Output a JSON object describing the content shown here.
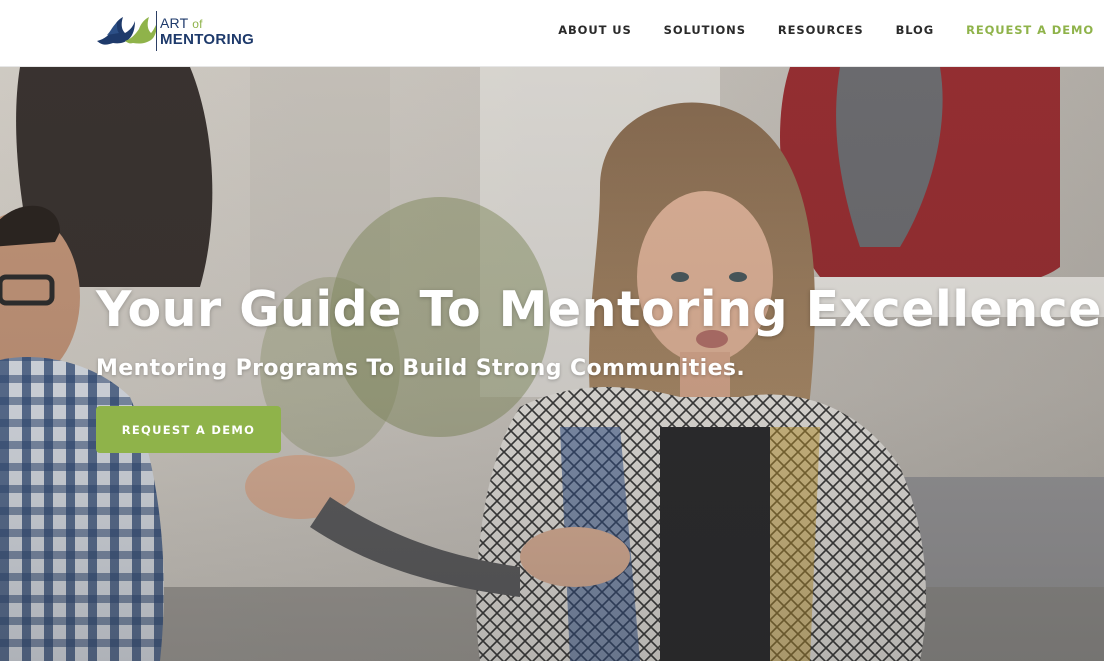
{
  "brand": {
    "logo_line1": "ART",
    "logo_of": "of",
    "logo_line2": "MENTORING",
    "logo_icon": "flying-birds-logo",
    "primary_color": "#1e3a6b",
    "accent_color": "#8fb34a"
  },
  "nav": {
    "items": [
      {
        "label": "ABOUT US"
      },
      {
        "label": "SOLUTIONS"
      },
      {
        "label": "RESOURCES"
      },
      {
        "label": "BLOG"
      }
    ],
    "cta": {
      "label": "REQUEST A DEMO"
    }
  },
  "hero": {
    "title": "Your Guide To Mentoring Excellence.",
    "subtitle": "Mentoring Programs To Build Strong Communities.",
    "button_label": "REQUEST A DEMO",
    "background": "photo-of-people-in-mentoring-discussion"
  }
}
